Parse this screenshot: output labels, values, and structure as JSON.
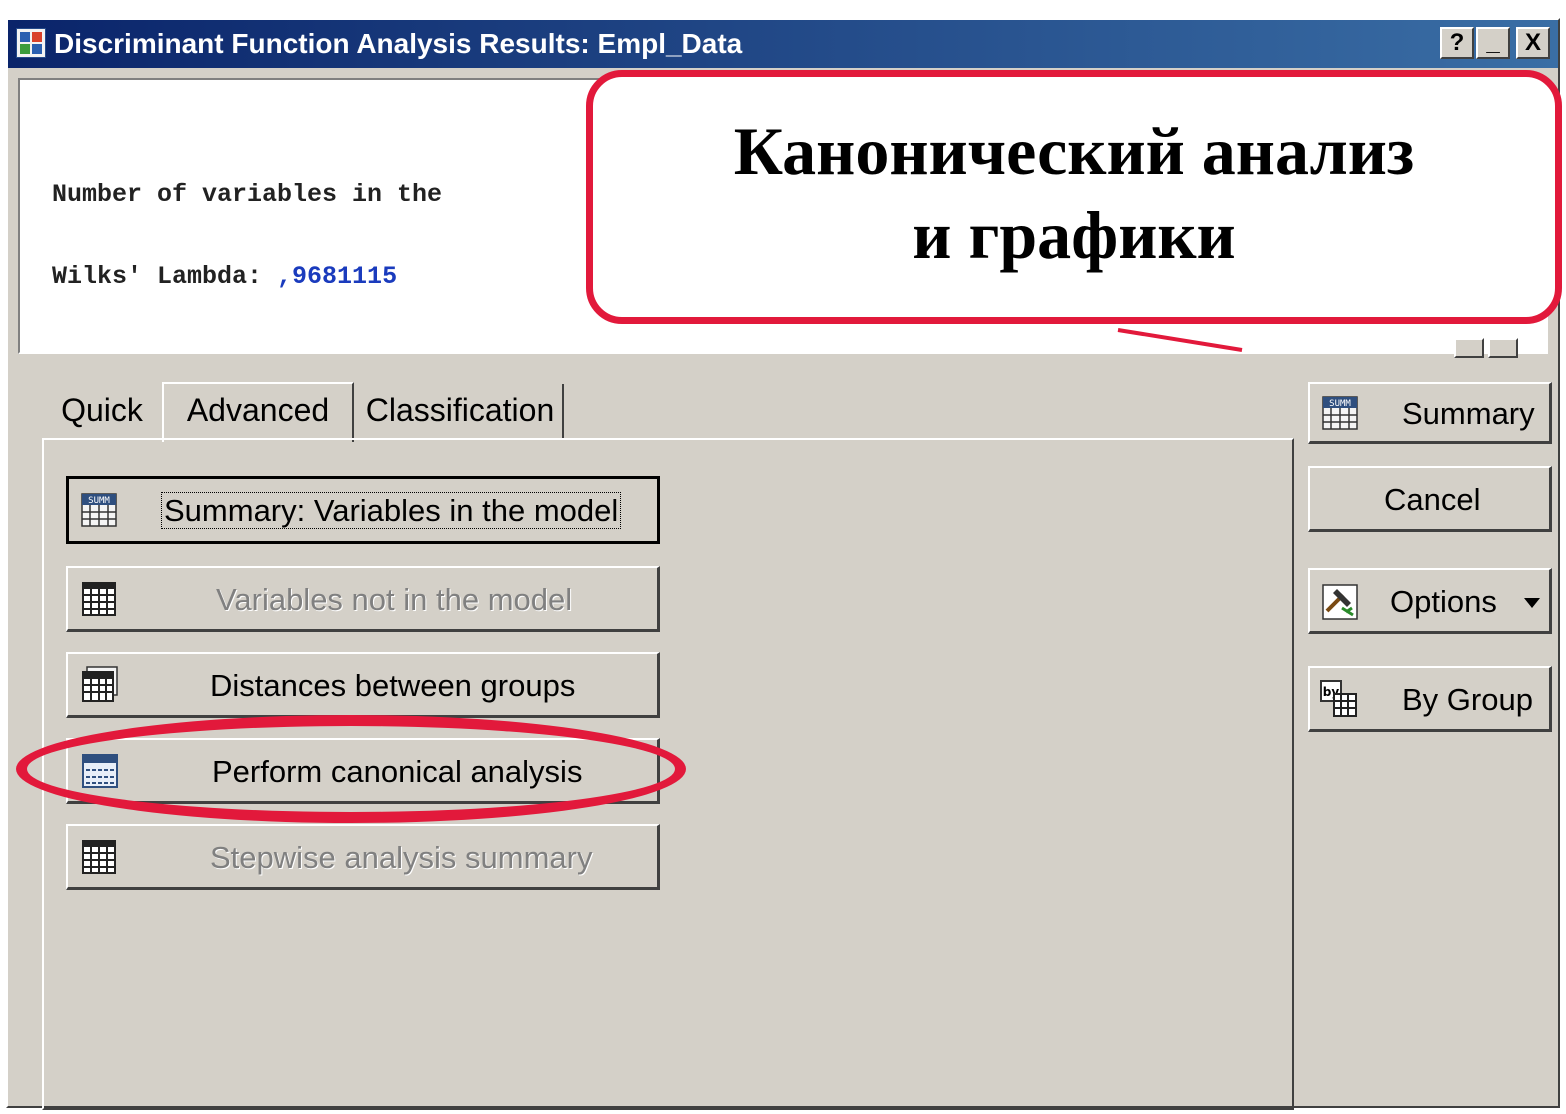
{
  "window": {
    "title": "Discriminant Function Analysis Results: Empl_Data",
    "controls": {
      "help": "?",
      "minimize": "_",
      "close": "X"
    }
  },
  "output": {
    "line1": "Number of variables in the",
    "line2_label": "Wilks' Lambda: ",
    "line2_value": ",9681115"
  },
  "callout": {
    "line1": "Канонический анализ",
    "line2": "и графики"
  },
  "tabs": [
    {
      "label": "Quick",
      "active": false
    },
    {
      "label": "Advanced",
      "active": true
    },
    {
      "label": "Classification",
      "active": false
    }
  ],
  "buttons": {
    "summary_vars": {
      "label": "Summary:  Variables in the model",
      "icon": "summary-table-icon",
      "enabled": true
    },
    "vars_not_in": {
      "label": "Variables not in the model",
      "icon": "grid-table-icon",
      "enabled": false
    },
    "distances": {
      "label": "Distances between groups",
      "icon": "spreadsheet-icon",
      "enabled": true
    },
    "canonical": {
      "label": "Perform canonical analysis",
      "icon": "canonical-table-icon",
      "enabled": true,
      "highlighted": true
    },
    "stepwise": {
      "label": "Stepwise analysis summary",
      "icon": "grid-table-icon",
      "enabled": false
    }
  },
  "side_buttons": {
    "summary": {
      "label": "Summary",
      "icon": "summary-table-icon"
    },
    "cancel": {
      "label": "Cancel"
    },
    "options": {
      "label": "Options",
      "icon": "options-hammer-icon"
    },
    "bygroup": {
      "label": "By Group",
      "icon": "by-group-icon"
    }
  },
  "colors": {
    "highlight": "#e2193b",
    "title_bar": "#0a246a",
    "dialog_bg": "#d4d0c8",
    "value_blue": "#1a3bbd"
  }
}
